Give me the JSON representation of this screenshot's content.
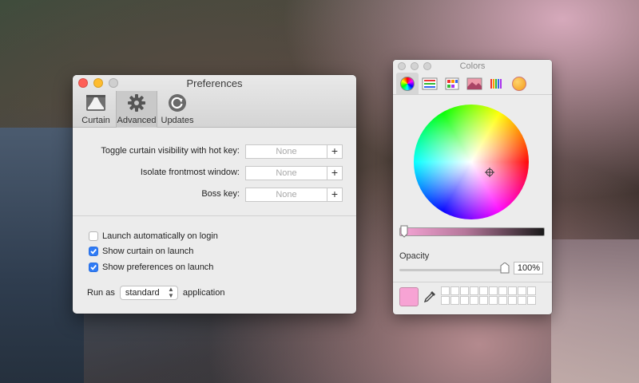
{
  "preferences": {
    "title": "Preferences",
    "tabs": [
      {
        "label": "Curtain",
        "icon": "curtain-icon"
      },
      {
        "label": "Advanced",
        "icon": "gear-icon",
        "active": true
      },
      {
        "label": "Updates",
        "icon": "refresh-icon"
      }
    ],
    "hotkeys": [
      {
        "label": "Toggle curtain visibility with hot key:",
        "value": "None",
        "add": "+"
      },
      {
        "label": "Isolate frontmost window:",
        "value": "None",
        "add": "+"
      },
      {
        "label": "Boss key:",
        "value": "None",
        "add": "+"
      }
    ],
    "checkboxes": [
      {
        "label": "Launch automatically on login",
        "checked": false
      },
      {
        "label": "Show curtain on launch",
        "checked": true
      },
      {
        "label": "Show preferences on launch",
        "checked": true
      }
    ],
    "run_as": {
      "prefix": "Run as",
      "selected": "standard",
      "suffix": "application"
    }
  },
  "colors_panel": {
    "title": "Colors",
    "tabs": [
      "color-wheel-icon",
      "sliders-icon",
      "palettes-icon",
      "image-palettes-icon",
      "pencils-icon",
      "crayons-icon"
    ],
    "brightness_fraction": 0.0,
    "opacity_label": "Opacity",
    "opacity_value": "100%",
    "current_color": "#f7a3d4",
    "accent": "#2f7bf6"
  }
}
